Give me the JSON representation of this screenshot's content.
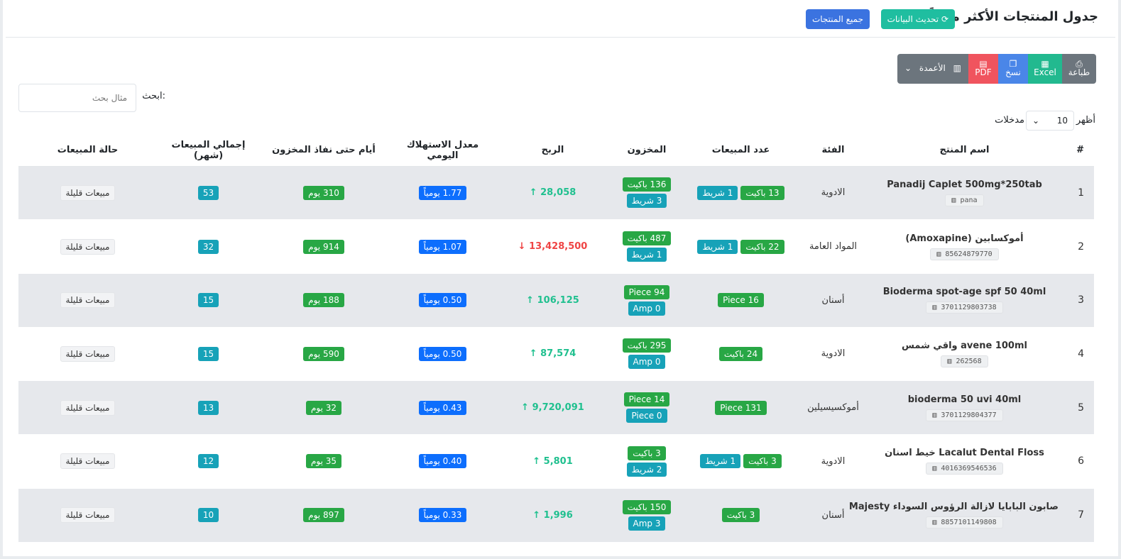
{
  "header": {
    "title": "جدول المنتجات الأكثر مبيعاً",
    "refresh_label": "تحديث البيانات",
    "all_products_label": "جميع المنتجات"
  },
  "buttons": {
    "print": "طباعة",
    "excel": "Excel",
    "copy": "نسخ",
    "pdf": "PDF",
    "columns": "الأعمدة"
  },
  "search": {
    "label": "ابحث:",
    "placeholder": "مثال بحث"
  },
  "length": {
    "show": "أظهر",
    "value": "10",
    "entries": "مدخلات"
  },
  "columns": [
    "#",
    "اسم المنتج",
    "الفئة",
    "عدد المبيعات",
    "المخزون",
    "الربح",
    "معدل الاستهلاك اليومي",
    "أيام حتى نفاذ المخزون",
    "إجمالي المبيعات (شهر)",
    "حالة المبيعات"
  ],
  "rows": [
    {
      "num": "1",
      "name": "Panadij Caplet 500mg*250tab",
      "barcode": "pana",
      "category": "الادوية",
      "sales": [
        "13 باكيت",
        "1 شريط"
      ],
      "stock": [
        "136 باكيت",
        "3 شريط"
      ],
      "profit": "28,058",
      "profit_dir": "up",
      "rate": "1.77 يومياً",
      "days": "310 يوم",
      "total": "53",
      "status": "مبيعات قليلة"
    },
    {
      "num": "2",
      "name": "أموكسابين (Amoxapine)",
      "barcode": "85624879770",
      "category": "المواد العامة",
      "sales": [
        "22 باكيت",
        "1 شريط"
      ],
      "stock": [
        "487 باكيت",
        "1 شريط"
      ],
      "profit": "13,428,500",
      "profit_dir": "down",
      "rate": "1.07 يومياً",
      "days": "914 يوم",
      "total": "32",
      "status": "مبيعات قليلة"
    },
    {
      "num": "3",
      "name": "Bioderma spot-age spf 50 40ml",
      "barcode": "3701129803738",
      "category": "أسنان",
      "sales": [
        "Piece 16"
      ],
      "stock": [
        "Piece 94",
        "Amp 0"
      ],
      "profit": "106,125",
      "profit_dir": "up",
      "rate": "0.50 يومياً",
      "days": "188 يوم",
      "total": "15",
      "status": "مبيعات قليلة"
    },
    {
      "num": "4",
      "name": "avene 100ml واقي شمس",
      "barcode": "262568",
      "category": "الادوية",
      "sales": [
        "24 باكيت"
      ],
      "stock": [
        "295 باكيت",
        "Amp 0"
      ],
      "profit": "87,574",
      "profit_dir": "up",
      "rate": "0.50 يومياً",
      "days": "590 يوم",
      "total": "15",
      "status": "مبيعات قليلة"
    },
    {
      "num": "5",
      "name": "bioderma 50 uvi 40ml",
      "barcode": "3701129804377",
      "category": "أموكسيسيلين",
      "sales": [
        "Piece 131"
      ],
      "stock": [
        "Piece 14",
        "Piece 0"
      ],
      "profit": "9,720,091",
      "profit_dir": "up",
      "rate": "0.43 يومياً",
      "days": "32 يوم",
      "total": "13",
      "status": "مبيعات قليلة"
    },
    {
      "num": "6",
      "name": "Lacalut Dental Floss خيط اسنان",
      "barcode": "4016369546536",
      "category": "الادوية",
      "sales": [
        "3 باكيت",
        "1 شريط"
      ],
      "stock": [
        "3 باكيت",
        "2 شريط"
      ],
      "profit": "5,801",
      "profit_dir": "up",
      "rate": "0.40 يومياً",
      "days": "35 يوم",
      "total": "12",
      "status": "مبيعات قليلة"
    },
    {
      "num": "7",
      "name": "صابون البابايا لازالة الرؤوس السوداء Majesty",
      "barcode": "8857101149808",
      "category": "أسنان",
      "sales": [
        "3 باكيت"
      ],
      "stock": [
        "150 باكيت",
        "Amp 3"
      ],
      "profit": "1,996",
      "profit_dir": "up",
      "rate": "0.33 يومياً",
      "days": "897 يوم",
      "total": "10",
      "status": "مبيعات قليلة"
    }
  ]
}
